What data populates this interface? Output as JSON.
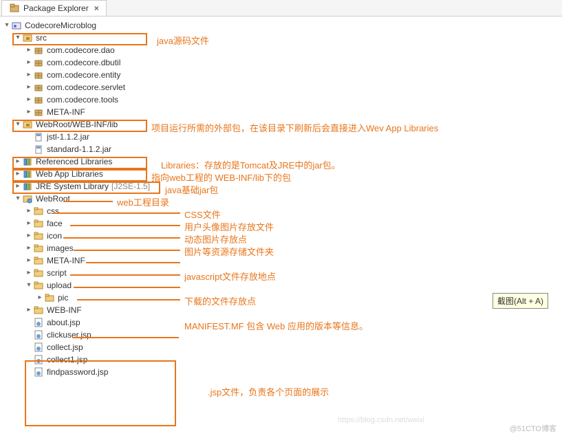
{
  "tab": {
    "title": "Package Explorer",
    "close": "×"
  },
  "tree": {
    "project": "CodecoreMicroblog",
    "src": "src",
    "pkg_dao": "com.codecore.dao",
    "pkg_dbutil": "com.codecore.dbutil",
    "pkg_entity": "com.codecore.entity",
    "pkg_servlet": "com.codecore.servlet",
    "pkg_tools": "com.codecore.tools",
    "metainf1": "META-INF",
    "webinf_lib": "WebRoot/WEB-INF/lib",
    "jstl_jar": "jstl-1.1.2.jar",
    "standard_jar": "standard-1.1.2.jar",
    "ref_lib": "Referenced Libraries",
    "webapp_lib": "Web App Libraries",
    "jre_lib": "JRE System Library",
    "jre_decor": "[J2SE-1.5]",
    "webroot": "WebRoot",
    "css": "css",
    "face": "face",
    "icon": "icon",
    "images": "images",
    "metainf2": "META-INF",
    "script": "script",
    "upload": "upload",
    "pic": "pic",
    "webinf": "WEB-INF",
    "about": "about.jsp",
    "clickuser": "clickuser.jsp",
    "collect": "collect.jsp",
    "collect1": "collect1.jsp",
    "findpassword": "findpassword.jsp"
  },
  "annotations": {
    "src": "java源码文件",
    "webinf_lib": "项目运行所需的外部包，在该目录下刷新后会直接进入Wev App Libraries",
    "ref_lib": "Libraries：存放的是Tomcat及JRE中的jar包。",
    "webapp_lib": "指向web工程的 WEB-INF/lib下的包",
    "jre_lib": "java基础jar包",
    "webroot": "web工程目录",
    "css": "CSS文件",
    "face": "用户头像图片存放文件",
    "icon": "动态图片存放点",
    "images": "图片等资源存储文件夹",
    "metainf2": "MANIFEST.MF 包含 Web 应用的版本等信息。",
    "script": "javascript文件存放地点",
    "upload": "下载的文件存放点",
    "jsp": ".jsp文件，负责各个页面的展示"
  },
  "tooltip": "截图(Alt + A)",
  "watermark": "@51CTO博客",
  "watermark2": "https://blog.csdn.net/weixi"
}
